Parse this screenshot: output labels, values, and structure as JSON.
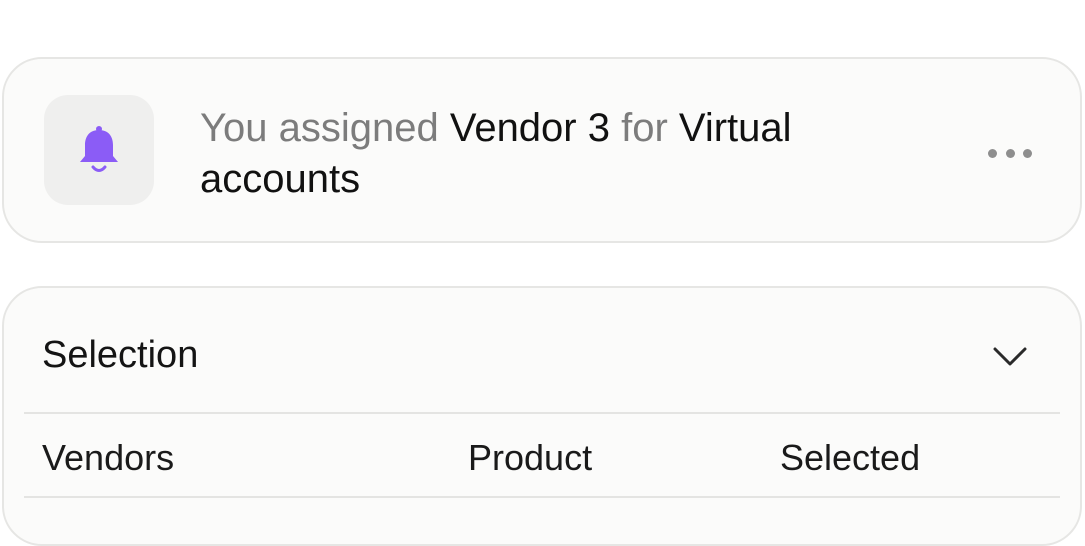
{
  "notification": {
    "icon": "bell-icon",
    "icon_color": "#8b5cf6",
    "text_prefix": "You assigned ",
    "vendor": "Vendor 3",
    "text_middle": " for ",
    "product": "Virtual accounts",
    "more_icon": "more-horizontal-icon"
  },
  "selection": {
    "title": "Selection",
    "toggle_icon": "chevron-down-icon",
    "columns": [
      "Vendors",
      "Product",
      "Selected"
    ]
  }
}
